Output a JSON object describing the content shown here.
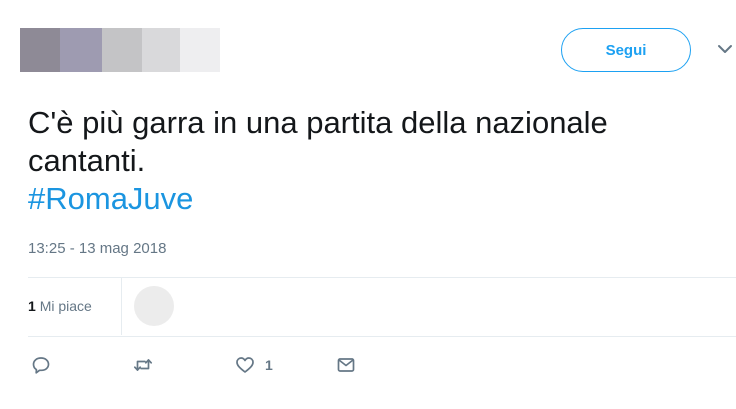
{
  "header": {
    "follow_label": "Segui"
  },
  "tweet": {
    "text_line1": "C'è più garra in una partita della nazionale",
    "text_line2": "cantanti.",
    "hashtag": "#RomaJuve",
    "timestamp": "13:25 - 13 mag 2018"
  },
  "stats": {
    "like_count": "1",
    "like_label": "Mi piace"
  },
  "actions": {
    "like_count": "1"
  },
  "colors": {
    "accent": "#1da1f2",
    "hashtag": "#1b95e0",
    "muted": "#657786"
  },
  "icons": [
    "reply-icon",
    "retweet-icon",
    "heart-icon",
    "message-icon",
    "chevron-down-icon"
  ]
}
